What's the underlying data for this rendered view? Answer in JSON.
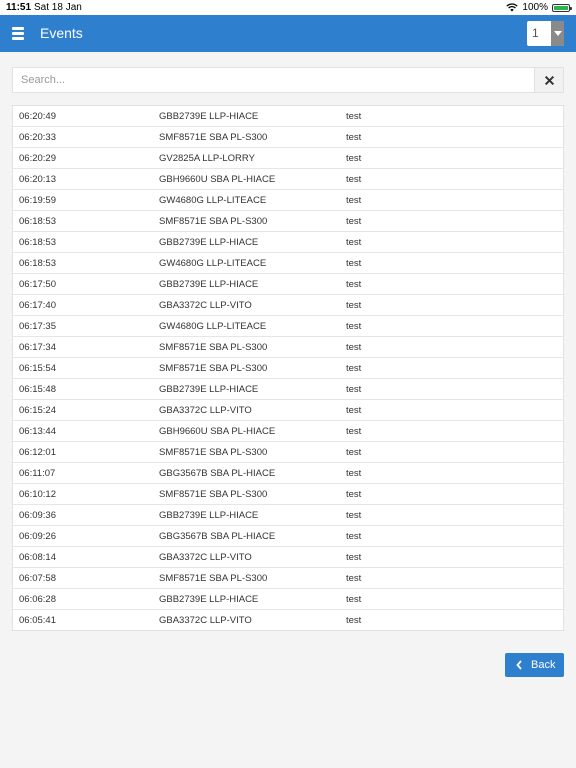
{
  "status_bar": {
    "time": "11:51",
    "date": "Sat 18 Jan",
    "battery": "100%"
  },
  "header": {
    "title": "Events",
    "page_select_value": "1",
    "accent_color": "#2f7fcf"
  },
  "search": {
    "placeholder": "Search...",
    "value": ""
  },
  "events": [
    {
      "time": "06:20:49",
      "vehicle": "GBB2739E LLP-HIACE",
      "description": "test"
    },
    {
      "time": "06:20:33",
      "vehicle": "SMF8571E SBA PL-S300",
      "description": "test"
    },
    {
      "time": "06:20:29",
      "vehicle": "GV2825A LLP-LORRY",
      "description": "test"
    },
    {
      "time": "06:20:13",
      "vehicle": "GBH9660U SBA PL-HIACE",
      "description": "test"
    },
    {
      "time": "06:19:59",
      "vehicle": "GW4680G LLP-LITEACE",
      "description": "test"
    },
    {
      "time": "06:18:53",
      "vehicle": "SMF8571E SBA PL-S300",
      "description": "test"
    },
    {
      "time": "06:18:53",
      "vehicle": "GBB2739E LLP-HIACE",
      "description": "test"
    },
    {
      "time": "06:18:53",
      "vehicle": "GW4680G LLP-LITEACE",
      "description": "test"
    },
    {
      "time": "06:17:50",
      "vehicle": "GBB2739E LLP-HIACE",
      "description": "test"
    },
    {
      "time": "06:17:40",
      "vehicle": "GBA3372C LLP-VITO",
      "description": "test"
    },
    {
      "time": "06:17:35",
      "vehicle": "GW4680G LLP-LITEACE",
      "description": "test"
    },
    {
      "time": "06:17:34",
      "vehicle": "SMF8571E SBA PL-S300",
      "description": "test"
    },
    {
      "time": "06:15:54",
      "vehicle": "SMF8571E SBA PL-S300",
      "description": "test"
    },
    {
      "time": "06:15:48",
      "vehicle": "GBB2739E LLP-HIACE",
      "description": "test"
    },
    {
      "time": "06:15:24",
      "vehicle": "GBA3372C LLP-VITO",
      "description": "test"
    },
    {
      "time": "06:13:44",
      "vehicle": "GBH9660U SBA PL-HIACE",
      "description": "test"
    },
    {
      "time": "06:12:01",
      "vehicle": "SMF8571E SBA PL-S300",
      "description": "test"
    },
    {
      "time": "06:11:07",
      "vehicle": "GBG3567B SBA PL-HIACE",
      "description": "test"
    },
    {
      "time": "06:10:12",
      "vehicle": "SMF8571E SBA PL-S300",
      "description": "test"
    },
    {
      "time": "06:09:36",
      "vehicle": "GBB2739E LLP-HIACE",
      "description": "test"
    },
    {
      "time": "06:09:26",
      "vehicle": "GBG3567B SBA PL-HIACE",
      "description": "test"
    },
    {
      "time": "06:08:14",
      "vehicle": "GBA3372C LLP-VITO",
      "description": "test"
    },
    {
      "time": "06:07:58",
      "vehicle": "SMF8571E SBA PL-S300",
      "description": "test"
    },
    {
      "time": "06:06:28",
      "vehicle": "GBB2739E LLP-HIACE",
      "description": "test"
    },
    {
      "time": "06:05:41",
      "vehicle": "GBA3372C LLP-VITO",
      "description": "test"
    }
  ],
  "footer": {
    "back_label": "Back"
  },
  "icons": {
    "menu": "hamburger-icon",
    "clear": "close-icon",
    "back": "chevron-left-icon",
    "wifi": "wifi-icon",
    "battery": "battery-icon"
  }
}
